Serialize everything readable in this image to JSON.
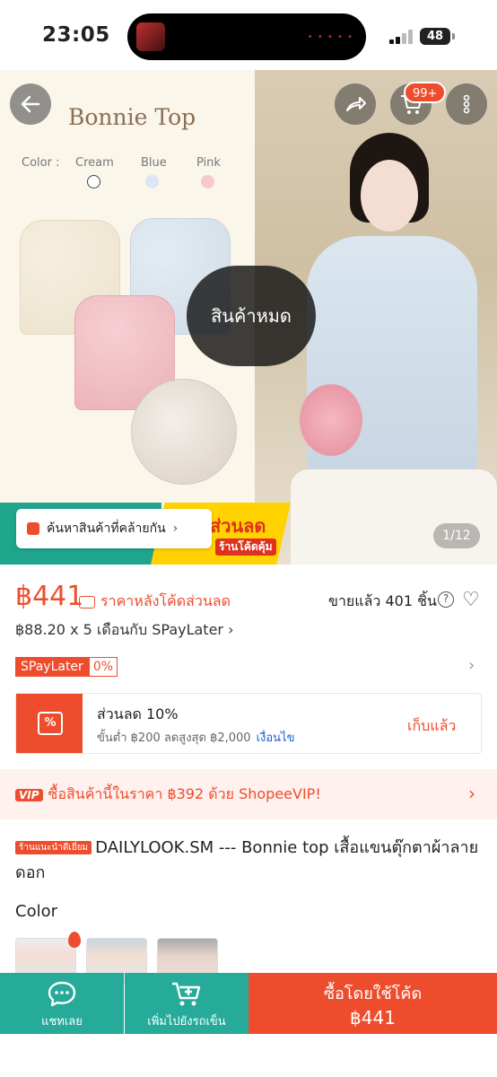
{
  "status_bar": {
    "time": "23:05",
    "battery": "48"
  },
  "hero": {
    "image_title": "Bonnie Top",
    "color_label": "Color :",
    "colors": [
      "Cream",
      "Blue",
      "Pink"
    ],
    "out_of_stock": "สินค้าหมด",
    "cart_badge": "99+",
    "page_indicator": "1/12",
    "find_similar": "ค้นหาสินค้าที่คล้ายกัน",
    "banner_discount": "ส่วนลด",
    "banner_sub": "ร้านโค้ดคุ้ม"
  },
  "price": {
    "amount": "฿441",
    "after_code": "ราคาหลังโค้ดส่วนลด",
    "sold": "ขายแล้ว 401 ชิ้น",
    "installment": "฿88.20 x 5 เดือนกับ SPayLater ›",
    "spaylater": "SPayLater",
    "spaylater_rate": "0%"
  },
  "voucher": {
    "title": "ส่วนลด 10%",
    "condition": "ขั้นต่ำ ฿200 ลดสูงสุด ฿2,000",
    "terms": "เงื่อนไข",
    "collected": "เก็บแล้ว"
  },
  "vip": {
    "tag": "VIP",
    "text": "ซื้อสินค้านี้ในราคา ฿392 ด้วย ShopeeVIP!"
  },
  "product": {
    "shop_tag": "ร้านแนะนำดีเยี่ยม",
    "title": "DAILYLOOK.SM --- Bonnie top เสื้อแขนตุ๊กตาผ้าลายดอก"
  },
  "variants": {
    "heading": "Color"
  },
  "bottom_bar": {
    "chat": "แชทเลย",
    "add_cart": "เพิ่มไปยังรถเข็น",
    "buy_label": "ซื้อโดยใช้โค้ด",
    "buy_price": "฿441"
  },
  "colors": {
    "accent": "#ee4d2d",
    "teal": "#26aa99"
  }
}
